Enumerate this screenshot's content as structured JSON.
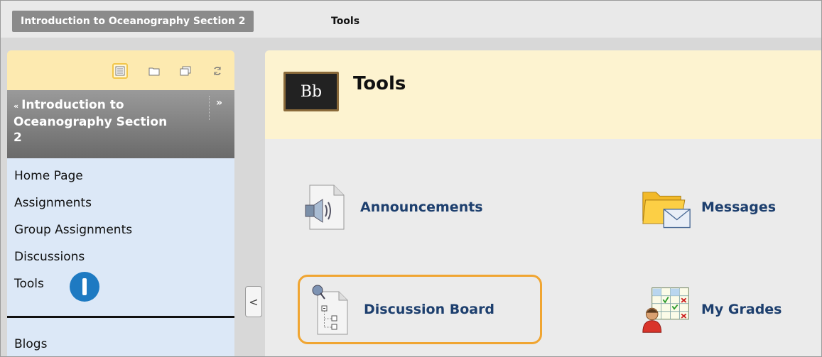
{
  "breadcrumb": {
    "course": "Introduction to Oceanography Section 2",
    "current": "Tools"
  },
  "sidebar": {
    "toolbar_icons": [
      "list-view-icon",
      "folder-view-icon",
      "window-view-icon",
      "refresh-icon"
    ],
    "course_title": "Introduction to Oceanography Section 2",
    "collapse_caret": "«",
    "expand_label": "»",
    "items": [
      {
        "label": "Home Page"
      },
      {
        "label": "Assignments"
      },
      {
        "label": "Group Assignments"
      },
      {
        "label": "Discussions"
      },
      {
        "label": "Tools"
      }
    ],
    "badge_label": "1",
    "bottom_items": [
      {
        "label": "Blogs"
      }
    ]
  },
  "collapse_handle": "<",
  "main": {
    "title": "Tools",
    "logo_text": "Bb",
    "tools": [
      {
        "label": "Announcements",
        "icon": "announcements-icon"
      },
      {
        "label": "Messages",
        "icon": "messages-icon"
      },
      {
        "label": "Discussion Board",
        "icon": "discussion-board-icon"
      },
      {
        "label": "My Grades",
        "icon": "my-grades-icon"
      }
    ]
  },
  "colors": {
    "accent": "#f0a531",
    "link": "#1d3f6e",
    "badge": "#1e7ac2"
  }
}
